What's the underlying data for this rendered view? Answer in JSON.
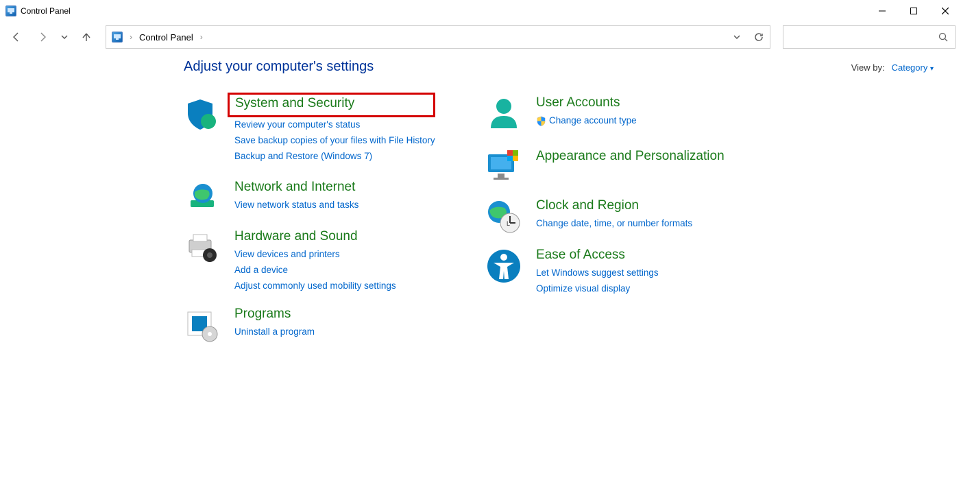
{
  "window": {
    "title": "Control Panel"
  },
  "breadcrumb": {
    "root": "Control Panel"
  },
  "page": {
    "heading": "Adjust your computer's settings",
    "view_by_label": "View by:",
    "view_by_value": "Category"
  },
  "categories": {
    "system_security": {
      "title": "System and Security",
      "links": [
        "Review your computer's status",
        "Save backup copies of your files with File History",
        "Backup and Restore (Windows 7)"
      ]
    },
    "network": {
      "title": "Network and Internet",
      "links": [
        "View network status and tasks"
      ]
    },
    "hardware": {
      "title": "Hardware and Sound",
      "links": [
        "View devices and printers",
        "Add a device",
        "Adjust commonly used mobility settings"
      ]
    },
    "programs": {
      "title": "Programs",
      "links": [
        "Uninstall a program"
      ]
    },
    "users": {
      "title": "User Accounts",
      "links": [
        "Change account type"
      ]
    },
    "appearance": {
      "title": "Appearance and Personalization"
    },
    "clock": {
      "title": "Clock and Region",
      "links": [
        "Change date, time, or number formats"
      ]
    },
    "ease": {
      "title": "Ease of Access",
      "links": [
        "Let Windows suggest settings",
        "Optimize visual display"
      ]
    }
  }
}
